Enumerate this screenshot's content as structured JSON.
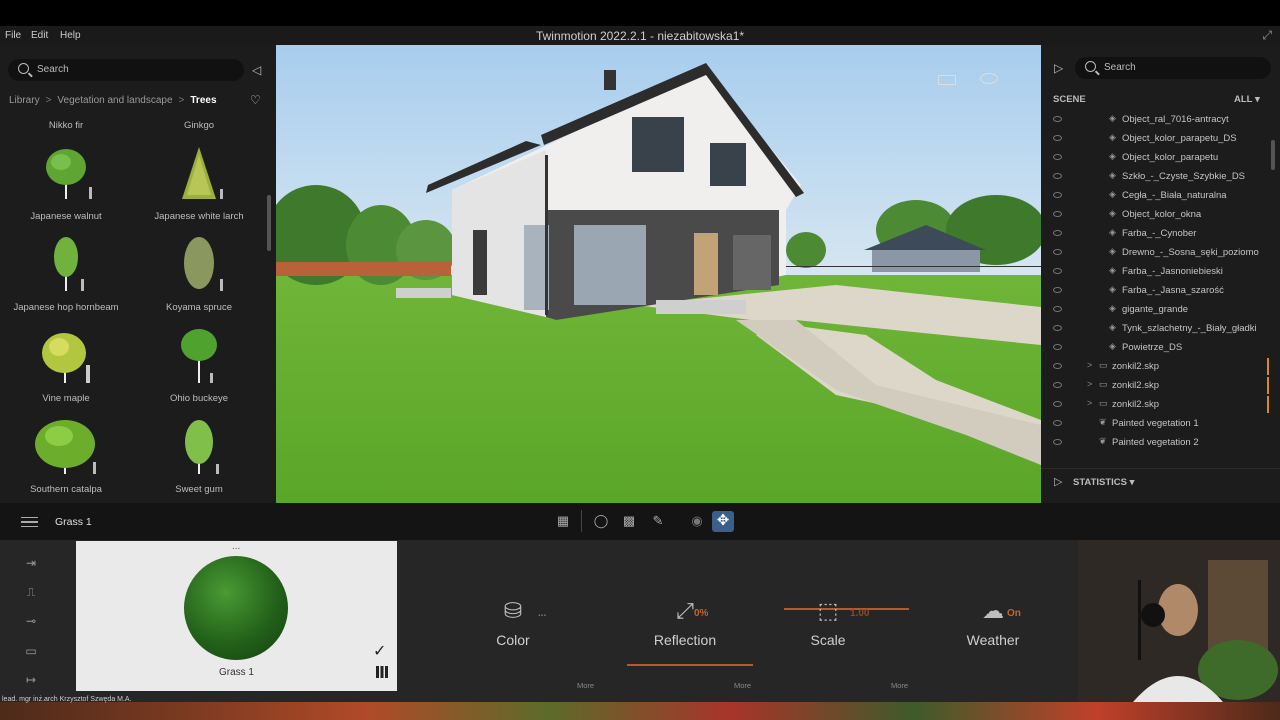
{
  "app": {
    "title": "Twinmotion 2022.2.1 - niezabitowska1*",
    "menu": [
      "File",
      "Edit",
      "Help"
    ]
  },
  "library": {
    "search_placeholder": "Search",
    "breadcrumb": [
      "Library",
      "Vegetation and landscape",
      "Trees"
    ],
    "items_top": [
      "Nikko fir",
      "Ginkgo"
    ],
    "items": [
      {
        "label": "Japanese walnut",
        "icon": "walnut-tree"
      },
      {
        "label": "Japanese white larch",
        "icon": "larch-tree"
      },
      {
        "label": "Japanese hop hornbeam",
        "icon": "hornbeam-tree"
      },
      {
        "label": "Koyama spruce",
        "icon": "spruce-tree"
      },
      {
        "label": "Vine maple",
        "icon": "maple-tree"
      },
      {
        "label": "Ohio buckeye",
        "icon": "buckeye-tree"
      },
      {
        "label": "Southern catalpa",
        "icon": "catalpa-tree"
      },
      {
        "label": "Sweet gum",
        "icon": "sweetgum-tree"
      }
    ]
  },
  "scene": {
    "search_placeholder": "Search",
    "title": "SCENE",
    "filter": "ALL",
    "items": [
      {
        "label": "Object_ral_7016-antracyt",
        "type": "material"
      },
      {
        "label": "Object_kolor_parapetu_DS",
        "type": "material"
      },
      {
        "label": "Object_kolor_parapetu",
        "type": "material"
      },
      {
        "label": "Szkło_-_Czyste_Szybkie_DS",
        "type": "material"
      },
      {
        "label": "Cegła_-_Biała_naturalna",
        "type": "material"
      },
      {
        "label": "Object_kolor_okna",
        "type": "material"
      },
      {
        "label": "Farba_-_Cynober",
        "type": "material"
      },
      {
        "label": "Drewno_-_Sosna_sęki_poziomo",
        "type": "material"
      },
      {
        "label": "Farba_-_Jasnoniebieski",
        "type": "material"
      },
      {
        "label": "Farba_-_Jasna_szarość",
        "type": "material"
      },
      {
        "label": "gigante_grande",
        "type": "material"
      },
      {
        "label": "Tynk_szlachetny_-_Biały_gładki",
        "type": "material"
      },
      {
        "label": "Powietrze_DS",
        "type": "material"
      },
      {
        "label": "zonkil2.skp",
        "type": "folder"
      },
      {
        "label": "zonkil2.skp",
        "type": "folder"
      },
      {
        "label": "zonkil2.skp",
        "type": "folder"
      },
      {
        "label": "Painted vegetation 1",
        "type": "vegetation"
      },
      {
        "label": "Painted vegetation 2",
        "type": "vegetation"
      }
    ],
    "statistics_label": "STATISTICS"
  },
  "toolbar": {
    "material_name": "Grass 1"
  },
  "material": {
    "name": "Grass 1",
    "dots": "...",
    "properties": [
      {
        "name": "Color",
        "value": "...",
        "icon": "paint-bucket-icon"
      },
      {
        "name": "Reflection",
        "value": "0%",
        "icon": "reflection-icon"
      },
      {
        "name": "Scale",
        "value": "1.00",
        "icon": "scale-icon"
      },
      {
        "name": "Weather",
        "value": "On",
        "icon": "cloud-rain-icon"
      }
    ],
    "more_label": "More"
  },
  "overlay": {
    "credit": "lead. mgr inż.arch Krzysztof Szwęda M.A."
  },
  "colors": {
    "accent_orange": "#c2662d",
    "move_button": "#3a5f8a",
    "grass": "#5aa628",
    "sky": "#a7cdee"
  }
}
